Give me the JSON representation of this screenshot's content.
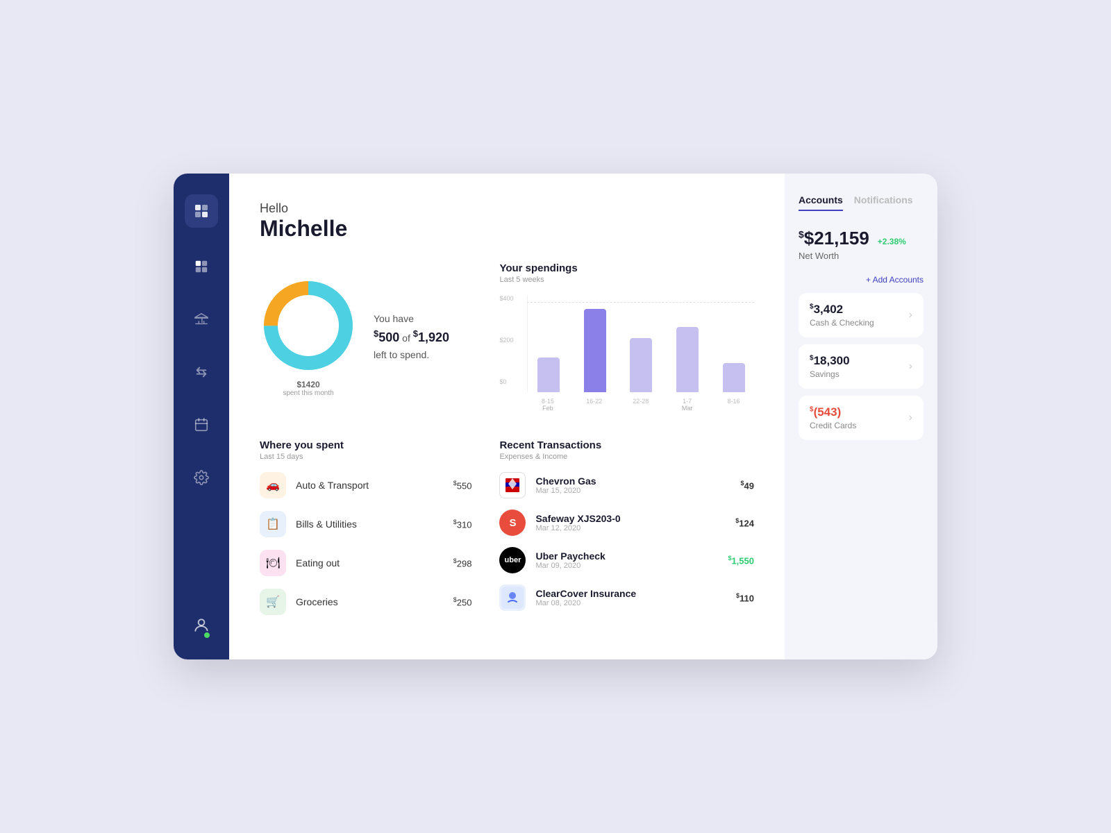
{
  "greeting": {
    "hello": "Hello",
    "name": "Michelle"
  },
  "budget": {
    "available": "$500",
    "total": "$1,920",
    "text_prefix": "You have",
    "text_of": "of",
    "text_suffix": "left to spend.",
    "spent": "$1420",
    "spent_label": "spent this month"
  },
  "spending_chart": {
    "title": "Your spendings",
    "subtitle": "Last 5 weeks",
    "y_labels": [
      "$400",
      "$200",
      "$0"
    ],
    "bars": [
      {
        "label": "8-15",
        "height_pct": 42,
        "sublabel": "Feb"
      },
      {
        "label": "16-22",
        "height_pct": 100,
        "sublabel": ""
      },
      {
        "label": "22-28",
        "height_pct": 65,
        "sublabel": ""
      },
      {
        "label": "1-7",
        "height_pct": 78,
        "sublabel": "Mar"
      },
      {
        "label": "8-16",
        "height_pct": 35,
        "sublabel": ""
      }
    ]
  },
  "where_spent": {
    "title": "Where you spent",
    "subtitle": "Last 15 days",
    "categories": [
      {
        "name": "Auto & Transport",
        "amount": "$550",
        "color": "#f5a623",
        "icon": "🚗"
      },
      {
        "name": "Bills & Utilities",
        "amount": "$310",
        "color": "#4a90e2",
        "icon": "📋"
      },
      {
        "name": "Eating out",
        "amount": "$298",
        "color": "#e91e96",
        "icon": "🍽"
      },
      {
        "name": "Groceries",
        "amount": "$250",
        "color": "#4caf50",
        "icon": "🛒"
      }
    ]
  },
  "transactions": {
    "title": "Recent Transactions",
    "subtitle": "Expenses & Income",
    "items": [
      {
        "name": "Chevron Gas",
        "date": "Mar 15, 2020",
        "amount": "$49",
        "positive": false,
        "logo_type": "chevron"
      },
      {
        "name": "Safeway XJS203-0",
        "date": "Mar 12, 2020",
        "amount": "$124",
        "positive": false,
        "logo_type": "safeway"
      },
      {
        "name": "Uber Paycheck",
        "date": "Mar 09, 2020",
        "amount": "$1,550",
        "positive": true,
        "logo_type": "uber"
      },
      {
        "name": "ClearCover Insurance",
        "date": "Mar 08, 2020",
        "amount": "$110",
        "positive": false,
        "logo_type": "clearcover"
      }
    ]
  },
  "sidebar": {
    "nav_items": [
      {
        "icon": "⊞",
        "label": "dashboard",
        "active": true
      },
      {
        "icon": "🏛",
        "label": "bank"
      },
      {
        "icon": "⇄",
        "label": "transfer"
      },
      {
        "icon": "📅",
        "label": "calendar"
      },
      {
        "icon": "⚙",
        "label": "settings"
      }
    ],
    "avatar_label": "profile"
  },
  "right_panel": {
    "tabs": [
      "Accounts",
      "Notifications"
    ],
    "active_tab": "Accounts",
    "net_worth": "$21,159",
    "net_worth_change": "+2.38%",
    "net_worth_label": "Net Worth",
    "add_accounts_label": "+ Add Accounts",
    "accounts": [
      {
        "balance": "$3,402",
        "type": "Cash & Checking",
        "negative": false
      },
      {
        "balance": "$18,300",
        "type": "Savings",
        "negative": false
      },
      {
        "balance": "$(543)",
        "type": "Credit Cards",
        "negative": true
      }
    ]
  }
}
